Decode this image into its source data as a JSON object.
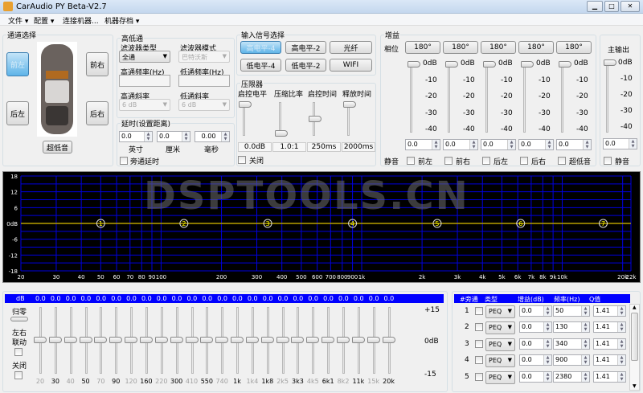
{
  "window": {
    "title": "CarAudio PY Beta-V2.7",
    "controls": [
      "minimize",
      "maximize",
      "close"
    ]
  },
  "menu": [
    {
      "label": "文件",
      "dropdown": true
    },
    {
      "label": "配置",
      "dropdown": true
    },
    {
      "label": "连接机器...",
      "dropdown": false
    },
    {
      "label": "机器存档",
      "dropdown": true
    }
  ],
  "channel": {
    "title": "通道选择",
    "front_left": "前左",
    "front_right": "前右",
    "rear_left": "后左",
    "rear_right": "后右",
    "subwoofer": "超低音",
    "selected": "前左"
  },
  "crossover": {
    "title": "高低通",
    "filter_type_label": "滤波器类型",
    "filter_type": "全通",
    "filter_mode_label": "滤波器模式",
    "filter_mode": "巴特沃斯",
    "hp_freq_label": "高通频率(Hz)",
    "hp_freq": "",
    "lp_freq_label": "低通频率(Hz)",
    "lp_freq": "",
    "hp_slope_label": "高通斜率",
    "hp_slope": "6 dB",
    "lp_slope_label": "低通斜率",
    "lp_slope": "6 dB"
  },
  "delay": {
    "title": "延时(设置距离)",
    "inch": "0.0",
    "inch_label": "英寸",
    "cm": "0.0",
    "cm_label": "厘米",
    "ms": "0.00",
    "ms_label": "毫秒",
    "bypass_label": "旁通延时"
  },
  "input": {
    "title": "输入信号选择",
    "buttons": [
      "高电平-4",
      "高电平-2",
      "光纤",
      "低电平-4",
      "低电平-2",
      "WIFI"
    ],
    "selected": "高电平-4"
  },
  "limiter": {
    "title": "压限器",
    "labels": [
      "启控电平",
      "压缩比率",
      "启控时间",
      "释放时间"
    ],
    "values": [
      "0.0dB",
      "1.0:1",
      "250ms",
      "2000ms"
    ],
    "levels": [
      1,
      0,
      0.5,
      1
    ],
    "off_label": "关闭"
  },
  "gain": {
    "title": "增益",
    "phase_label": "相位",
    "phase": [
      "180°",
      "180°",
      "180°",
      "180°",
      "180°"
    ],
    "scale": [
      "0dB",
      "-10",
      "-20",
      "-30",
      "-40"
    ],
    "values": [
      "0.0",
      "0.0",
      "0.0",
      "0.0",
      "0.0"
    ],
    "mute_label": "静音",
    "channels": [
      "前左",
      "前右",
      "后左",
      "后右",
      "超低音"
    ]
  },
  "master": {
    "title": "主输出",
    "scale": [
      "0dB",
      "-10",
      "-20",
      "-30",
      "-40"
    ],
    "value": "0.0",
    "mute_label": "静音"
  },
  "chart_data": {
    "type": "line",
    "xscale": "log",
    "xlim": [
      20,
      22000
    ],
    "ylim": [
      -18,
      18
    ],
    "grid": true,
    "ytick_labels": [
      "18",
      "12",
      "6",
      "0dB",
      "-6",
      "-12",
      "-18"
    ],
    "yticks": [
      18,
      12,
      6,
      0,
      -6,
      -12,
      -18
    ],
    "xticks": [
      20,
      30,
      40,
      50,
      60,
      70,
      80,
      90,
      100,
      200,
      300,
      400,
      500,
      600,
      700,
      800,
      900,
      1000,
      2000,
      3000,
      4000,
      5000,
      6000,
      7000,
      8000,
      9000,
      10000,
      20000,
      22000
    ],
    "xtick_labels": [
      "20",
      "30",
      "40",
      "50",
      "60",
      "70",
      "80",
      "90",
      "100",
      "200",
      "300",
      "400",
      "500",
      "600",
      "700",
      "800",
      "900",
      "1k",
      "2k",
      "3k",
      "4k",
      "5k",
      "6k",
      "7k",
      "8k",
      "9k",
      "10k",
      "20k",
      "22k"
    ],
    "curve_color": "#b8a000",
    "grid_color": "#0000e0",
    "series": [
      {
        "x": [
          20,
          22000
        ],
        "y": [
          0,
          0
        ]
      }
    ],
    "points": [
      {
        "label": "1",
        "x": 50,
        "y": 0
      },
      {
        "label": "2",
        "x": 130,
        "y": 0
      },
      {
        "label": "3",
        "x": 340,
        "y": 0
      },
      {
        "label": "4",
        "x": 900,
        "y": 0
      },
      {
        "label": "5",
        "x": 2380,
        "y": 0
      },
      {
        "label": "6",
        "x": 6200,
        "y": 0
      },
      {
        "label": "7",
        "x": 16000,
        "y": 0
      }
    ]
  },
  "watermark": "DSPTOOLS.CN",
  "geq": {
    "header_label": "dB",
    "values": [
      "0.0",
      "0.0",
      "0.0",
      "0.0",
      "0.0",
      "0.0",
      "0.0",
      "0.0",
      "0.0",
      "0.0",
      "0.0",
      "0.0",
      "0.0",
      "0.0",
      "0.0",
      "0.0",
      "0.0",
      "0.0",
      "0.0",
      "0.0",
      "0.0",
      "0.0",
      "0.0",
      "0.0"
    ],
    "freqs": [
      "20",
      "30",
      "40",
      "50",
      "70",
      "90",
      "120",
      "160",
      "220",
      "300",
      "410",
      "550",
      "740",
      "1k",
      "1k4",
      "1k8",
      "2k5",
      "3k3",
      "4k5",
      "6k1",
      "8k2",
      "11k",
      "15k",
      "20k"
    ],
    "reset_label": "归零",
    "link_label_1": "左右",
    "link_label_2": "联动",
    "off_label": "关闭",
    "scale": [
      "+15",
      "0dB",
      "-15"
    ]
  },
  "peq": {
    "headers": [
      "#旁通",
      "类型",
      "增益(dB)",
      "频率(Hz)",
      "Q值"
    ],
    "rows": [
      {
        "n": "1",
        "type": "PEQ",
        "gain": "0.0",
        "freq": "50",
        "q": "1.41"
      },
      {
        "n": "2",
        "type": "PEQ",
        "gain": "0.0",
        "freq": "130",
        "q": "1.41"
      },
      {
        "n": "3",
        "type": "PEQ",
        "gain": "0.0",
        "freq": "340",
        "q": "1.41"
      },
      {
        "n": "4",
        "type": "PEQ",
        "gain": "0.0",
        "freq": "900",
        "q": "1.41"
      },
      {
        "n": "5",
        "type": "PEQ",
        "gain": "0.0",
        "freq": "2380",
        "q": "1.41"
      }
    ]
  }
}
